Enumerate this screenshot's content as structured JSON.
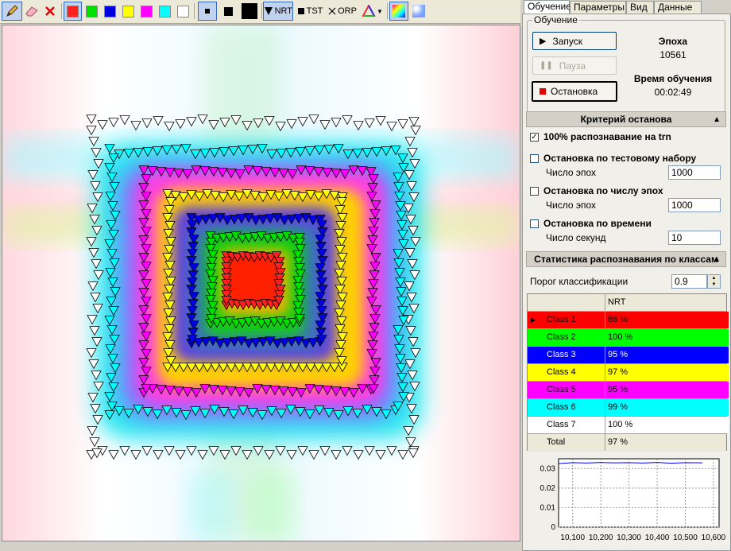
{
  "toolbar": {
    "nrt_label": "NRT",
    "tst_label": "TST",
    "orp_label": "ORP",
    "colors": [
      "#ff2020",
      "#00e000",
      "#0000e0",
      "#ffff00",
      "#ff00ff",
      "#00ffff",
      "#ffffff"
    ]
  },
  "tabs": [
    "Обучение",
    "Параметры",
    "Вид",
    "Данные"
  ],
  "training": {
    "group_title": "Обучение",
    "start_label": "Запуск",
    "pause_label": "Пауза",
    "stop_label": "Остановка",
    "epoch_title": "Эпоха",
    "epoch_value": "10561",
    "time_title": "Время обучения",
    "time_value": "00:02:49"
  },
  "stop_criteria": {
    "header": "Критерий останова",
    "opt1": "100% распознавание на trn",
    "opt2": "Остановка по тестовому набору",
    "opt2_sub": "Число эпох",
    "opt2_val": "1000",
    "opt3": "Остановка по числу эпох",
    "opt3_sub": "Число эпох",
    "opt3_val": "1000",
    "opt4": "Остановка по времени",
    "opt4_sub": "Число секунд",
    "opt4_val": "10"
  },
  "stats": {
    "header": "Статистика распознавания по классам",
    "threshold_label": "Порог классификации",
    "threshold_value": "0.9",
    "col_header": "NRT",
    "rows": [
      {
        "name": "Class 1",
        "value": "86 %",
        "color": "#ff0000",
        "text": "#000"
      },
      {
        "name": "Class 2",
        "value": "100 %",
        "color": "#00ff00",
        "text": "#000"
      },
      {
        "name": "Class 3",
        "value": "95 %",
        "color": "#0000ff",
        "text": "#fff"
      },
      {
        "name": "Class 4",
        "value": "97 %",
        "color": "#ffff00",
        "text": "#000"
      },
      {
        "name": "Class 5",
        "value": "95 %",
        "color": "#ff00ff",
        "text": "#000"
      },
      {
        "name": "Class 6",
        "value": "99 %",
        "color": "#00ffff",
        "text": "#000"
      },
      {
        "name": "Class 7",
        "value": "100 %",
        "color": "#ffffff",
        "text": "#000"
      }
    ],
    "total_label": "Total",
    "total_value": "97 %"
  },
  "chart_data": {
    "type": "line",
    "y_ticks": [
      "0.03",
      "0.02",
      "0.01",
      "0"
    ],
    "x_ticks": [
      "10,100",
      "10,200",
      "10,300",
      "10,400",
      "10,500",
      "10,600"
    ],
    "ylim": [
      0,
      0.035
    ],
    "xlim": [
      10050,
      10620
    ],
    "color": "#0000ff",
    "grid": true,
    "x": [
      10050,
      10100,
      10150,
      10200,
      10250,
      10300,
      10350,
      10400,
      10450,
      10500,
      10561
    ],
    "y": [
      0.0325,
      0.033,
      0.0328,
      0.0331,
      0.0329,
      0.033,
      0.0328,
      0.0331,
      0.0327,
      0.033,
      0.0329
    ]
  }
}
